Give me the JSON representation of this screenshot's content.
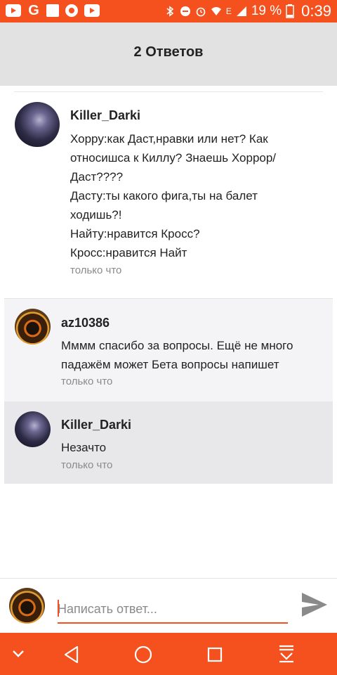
{
  "status_bar": {
    "battery": "19 %",
    "time": "0:39",
    "network": "E",
    "left_icons": [
      "youtube-icon",
      "google-icon",
      "photos-icon",
      "record-icon",
      "youtube-icon"
    ],
    "right_icons": [
      "bluetooth-icon",
      "do-not-disturb-icon",
      "alarm-icon",
      "wifi-icon",
      "signal-icon",
      "battery-icon"
    ]
  },
  "header": {
    "title": "2 Ответов"
  },
  "comments": [
    {
      "author": "Killer_Darki",
      "lines": [
        "Хорру:как Даст,нравки или нет? Как",
        "относишса к Киллу? Знаешь Хоррор/",
        "Даст????",
        "Дасту:ты какого фига,ты на балет",
        "ходишь?!",
        "Найту:нравится Кросс?",
        "Кросс:нравится Найт"
      ],
      "time": "только что"
    },
    {
      "author": "az10386",
      "lines": [
        "Мммм спасибо за вопросы. Ещё не много",
        "падажём может Бета вопросы напишет"
      ],
      "time": "только что"
    },
    {
      "author": "Killer_Darki",
      "lines": [
        "Незачто"
      ],
      "time": "только что"
    }
  ],
  "reply": {
    "placeholder": "Написать ответ...",
    "value": ""
  },
  "colors": {
    "accent": "#f4511e",
    "header_bg": "#e2e2e2"
  },
  "nav_icons": [
    "chevron-down-icon",
    "back-icon",
    "home-icon",
    "recents-icon",
    "download-icon"
  ]
}
